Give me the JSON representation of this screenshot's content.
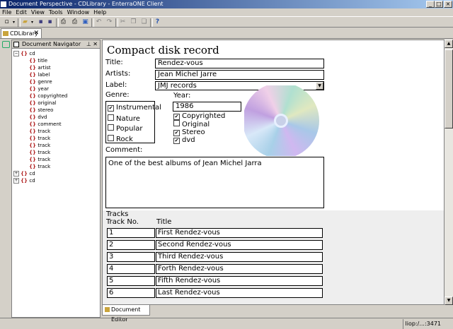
{
  "window": {
    "title": "Document Perspective - CDLibrary - EnterraONE Client",
    "controls": [
      "_",
      "□",
      "×"
    ]
  },
  "menu": [
    "File",
    "Edit",
    "View",
    "Tools",
    "Window",
    "Help"
  ],
  "toolbar_icons": [
    "new-icon",
    "dropdown-icon",
    "open-icon",
    "dropdown-icon",
    "save-icon",
    "save-all-icon",
    "print-icon",
    "print-preview-icon",
    "export-icon",
    "undo-icon",
    "redo-icon",
    "cut-icon",
    "copy-icon",
    "paste-icon",
    "help-icon"
  ],
  "editor_tab": {
    "label": "CDLibrary",
    "close": "✕"
  },
  "navigator": {
    "title": "Document Navigator",
    "pin": "⊥",
    "close": "✕",
    "tree": [
      {
        "label": "cd",
        "level": 0,
        "expander": "−"
      },
      {
        "label": "title",
        "level": 1
      },
      {
        "label": "artist",
        "level": 1
      },
      {
        "label": "label",
        "level": 1
      },
      {
        "label": "genre",
        "level": 1
      },
      {
        "label": "year",
        "level": 1
      },
      {
        "label": "copyrighted",
        "level": 1
      },
      {
        "label": "original",
        "level": 1
      },
      {
        "label": "stereo",
        "level": 1
      },
      {
        "label": "dvd",
        "level": 1
      },
      {
        "label": "comment",
        "level": 1
      },
      {
        "label": "track",
        "level": 1
      },
      {
        "label": "track",
        "level": 1
      },
      {
        "label": "track",
        "level": 1
      },
      {
        "label": "track",
        "level": 1
      },
      {
        "label": "track",
        "level": 1
      },
      {
        "label": "track",
        "level": 1
      },
      {
        "label": "cd",
        "level": 0,
        "expander": "+"
      },
      {
        "label": "cd",
        "level": 0,
        "expander": "+"
      }
    ]
  },
  "form": {
    "heading": "Compact disk record",
    "title_label": "Title:",
    "title_value": "Rendez-vous",
    "artists_label": "Artists:",
    "artists_value": "Jean Michel Jarre",
    "label_label": "Label:",
    "label_value": "JMJ records",
    "genre_label": "Genre:",
    "genres": [
      {
        "label": "Instrumental",
        "checked": true
      },
      {
        "label": "Nature",
        "checked": false
      },
      {
        "label": "Popular",
        "checked": false
      },
      {
        "label": "Rock",
        "checked": false
      }
    ],
    "year_label": "Year:",
    "year_value": "1986",
    "flags": [
      {
        "label": "Copyrighted",
        "checked": true
      },
      {
        "label": "Original",
        "checked": false
      },
      {
        "label": "Stereo",
        "checked": true
      },
      {
        "label": "dvd",
        "checked": true
      }
    ],
    "comment_label": "Comment:",
    "comment_value": "One of the best albums of Jean Michel Jarra",
    "tracks_label": "Tracks",
    "track_no_header": "Track No.",
    "track_title_header": "Title",
    "tracks": [
      {
        "no": "1",
        "title": "First Rendez-vous"
      },
      {
        "no": "2",
        "title": "Second Rendez-vous"
      },
      {
        "no": "3",
        "title": "Third Rendez-vous"
      },
      {
        "no": "4",
        "title": "Forth Rendez-vous"
      },
      {
        "no": "5",
        "title": "Fifth Rendez-vous"
      },
      {
        "no": "6",
        "title": "Last Rendez-vous"
      }
    ]
  },
  "bottom_tab": {
    "label": "Document Editor"
  },
  "status": {
    "connection": "liop:/...:3471"
  }
}
